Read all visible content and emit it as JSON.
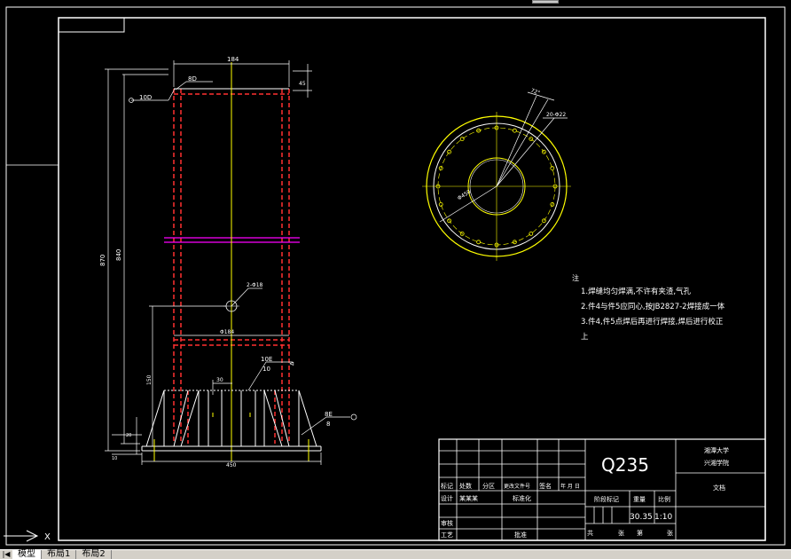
{
  "drawing": {
    "material": "Q235",
    "dimensions": {
      "top_width": "184",
      "top_offset": "45",
      "chamfer": "10D",
      "pipe_size": "8D",
      "total_height": "870",
      "inner_height": "840",
      "hole": "2-Φ18",
      "inner_width": "Φ184",
      "rib_gap": "30",
      "weld_top_a": "10E",
      "weld_top_b": "10",
      "weld_side_a": "8E",
      "weld_side_b": "8",
      "base_width": "450",
      "base_height": "150",
      "base_thick": "20",
      "small_dim": "10",
      "angle": "72°",
      "pcd": "Φ450",
      "bolt_spec": "20-Φ22"
    },
    "notes": {
      "heading": "注",
      "lines": [
        "1.焊缝均匀焊满,不许有夹渣,气孔",
        "2.件4与件5应同心,按JB2827-2焊接成一体",
        "3.件4,件5点焊后再进行焊接,焊后进行校正",
        "上"
      ]
    },
    "title_block": {
      "org_line1": "湘潭大学",
      "org_line2": "兴湘学院",
      "doc": "文档",
      "row_headers": [
        "标记",
        "处数",
        "分区",
        "更改文件号",
        "签名",
        "年 月 日"
      ],
      "designer": "设计",
      "standardize_label": "标准化",
      "designer_name": "某某某",
      "checker": "审核",
      "process": "工艺",
      "approve": "批准",
      "stage_mark": "阶段标记",
      "weight": "重量",
      "scale_label": "比例",
      "weight_value": "30.35",
      "scale_value": "1:10",
      "sheets_total": "共",
      "sheet": "张",
      "sheet_no": "第",
      "sheet_end": "张"
    }
  },
  "ucs": {
    "x_label": "X"
  },
  "tabs": {
    "model": "模型",
    "layout1": "布局1",
    "layout2": "布局2"
  },
  "colors": {
    "background": "#000000",
    "frame": "#ffffff",
    "dim": "#ffffff",
    "hidden": "#ff3030",
    "center": "#ffff00",
    "magenta": "#ff00ff"
  }
}
